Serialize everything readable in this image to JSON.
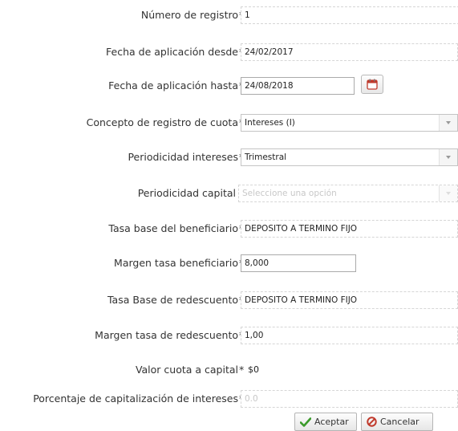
{
  "form": {
    "numero_registro": {
      "label": "Número de registro",
      "required_mark": "*",
      "value": "1"
    },
    "fecha_desde": {
      "label": "Fecha de aplicación desde",
      "required_mark": "*",
      "value": "24/02/2017"
    },
    "fecha_hasta": {
      "label": "Fecha de aplicación hasta",
      "required_mark": "*",
      "value": "24/08/2018"
    },
    "concepto": {
      "label": "Concepto de registro de cuota",
      "required_mark": "*",
      "value": "Intereses (I)"
    },
    "periodicidad_intereses": {
      "label": "Periodicidad intereses",
      "required_mark": "*",
      "value": "Trimestral"
    },
    "periodicidad_capital": {
      "label": "Periodicidad capital",
      "placeholder": "Seleccione una opción"
    },
    "tasa_base_beneficiario": {
      "label": "Tasa base del beneficiario",
      "required_mark": "*",
      "value": "DEPOSITO A TERMINO FIJO"
    },
    "margen_tasa_beneficiario": {
      "label": "Margen tasa beneficiario",
      "required_mark": "*",
      "value": "8,000"
    },
    "tasa_base_redescuento": {
      "label": "Tasa Base de redescuento",
      "required_mark": "*",
      "value": "DEPOSITO A TERMINO FIJO"
    },
    "margen_tasa_redescuento": {
      "label": "Margen tasa de redescuento",
      "required_mark": "*",
      "value": "1,00"
    },
    "valor_cuota_capital": {
      "label": "Valor cuota a capital",
      "required_mark": "*",
      "value": "$0"
    },
    "porcentaje_capitalizacion": {
      "label": "Porcentaje de capitalización de intereses",
      "required_mark": "*",
      "placeholder": "0.0"
    }
  },
  "actions": {
    "accept_label": "Aceptar",
    "cancel_label": "Cancelar"
  },
  "colors": {
    "accept_icon": "#3a9a2a",
    "cancel_icon": "#c0392b",
    "calendar_icon": "#c0392b"
  },
  "icons": {
    "calendar": "calendar-icon",
    "accept": "checkmark-icon",
    "cancel": "cancel-icon",
    "dropdown": "chevron-down-icon"
  }
}
